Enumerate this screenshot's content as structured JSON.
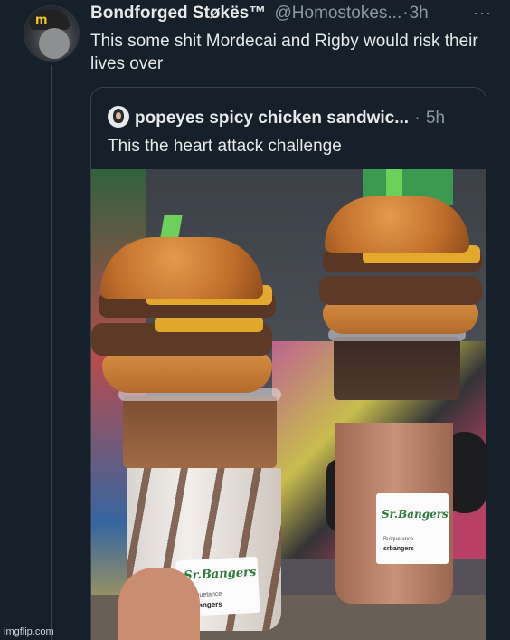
{
  "tweet": {
    "display_name": "Bondforged Støkës™",
    "handle": "@Homostokes...",
    "dot": "·",
    "time": "3h",
    "more": "···",
    "text": "This some shit Mordecai and Rigby would risk their lives over"
  },
  "quoted": {
    "display_name": "popeyes spicy chicken sandwic...",
    "dot": "·",
    "time": "5h",
    "text": "This the heart attack challenge"
  },
  "photo": {
    "label_brand": "Sr.Bangers",
    "label_sub": "Bulquetance",
    "label_ig": "srbangers"
  },
  "watermark": "imgflip.com"
}
